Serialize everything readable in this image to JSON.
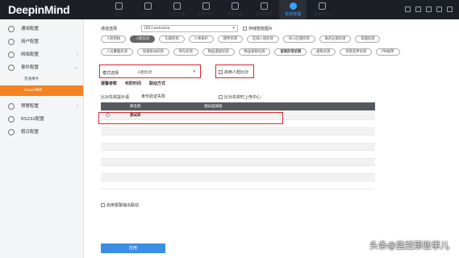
{
  "app": {
    "logo": "DeepinMind"
  },
  "nav": [
    {
      "label": "预览",
      "icon": "preview-icon"
    },
    {
      "label": "回放",
      "icon": "playback-icon"
    },
    {
      "label": "文件管理",
      "icon": "file-icon"
    },
    {
      "label": "智能分析",
      "icon": "analytics-icon"
    },
    {
      "label": "通道管理",
      "icon": "channel-icon"
    },
    {
      "label": "存储管理",
      "icon": "storage-icon"
    },
    {
      "label": "系统管理",
      "icon": "gear-icon"
    },
    {
      "label": "系统维护",
      "icon": "maintenance-icon"
    }
  ],
  "sidebar": {
    "items": [
      {
        "label": "通用配置",
        "icon": "gear-icon"
      },
      {
        "label": "用户配置",
        "icon": "user-icon"
      },
      {
        "label": "网络配置",
        "icon": "network-icon"
      },
      {
        "label": "事件配置",
        "icon": "event-icon"
      }
    ],
    "subitems": [
      "普通事件",
      "Smart事件"
    ],
    "items2": [
      {
        "label": "预警配置",
        "icon": "shield-icon"
      },
      {
        "label": "RS232配置",
        "icon": "serial-icon"
      },
      {
        "label": "假日配置",
        "icon": "calendar-icon"
      }
    ]
  },
  "form": {
    "channel_label": "通道选择",
    "channel_value": "[D1] welcome",
    "save_pic_label": "存储智能图片",
    "mode_label": "模式选择",
    "mode_value": "人脸比对",
    "enable_label": "启用人脸比对",
    "compare_fail_label": "比对失败提示语",
    "compare_fail_value": "身份验证失败",
    "upload_label": "比对失败时上传中心",
    "alarm_output_label": "启用报警输出联动",
    "apply_label": "应用"
  },
  "pills_row1": [
    "人脸抓拍",
    "人脸比对",
    "车辆检测",
    "人体保护",
    "越界侦测",
    "区域入侵侦测",
    "进入区域侦测",
    "离开区域侦测",
    "徘徊侦测"
  ],
  "pills_row2": [
    "人员聚集侦测",
    "快速移动侦测",
    "停车侦测",
    "物品遗留侦测",
    "物品拿取侦测",
    "音频异常侦测",
    "虚焦侦测",
    "场景变更侦测",
    "PIR报警"
  ],
  "subtabs": [
    "报警参数",
    "布防时间",
    "联动方式"
  ],
  "table": {
    "headers": [
      "",
      "库名称",
      "相似度阈值",
      ""
    ],
    "rows": [
      {
        "name": "测试库",
        "value": ""
      }
    ]
  },
  "watermark": "头条@监控那些事儿",
  "colors": {
    "accent": "#f58220",
    "highlight": "#d9262b",
    "button": "#3a8ee6"
  }
}
